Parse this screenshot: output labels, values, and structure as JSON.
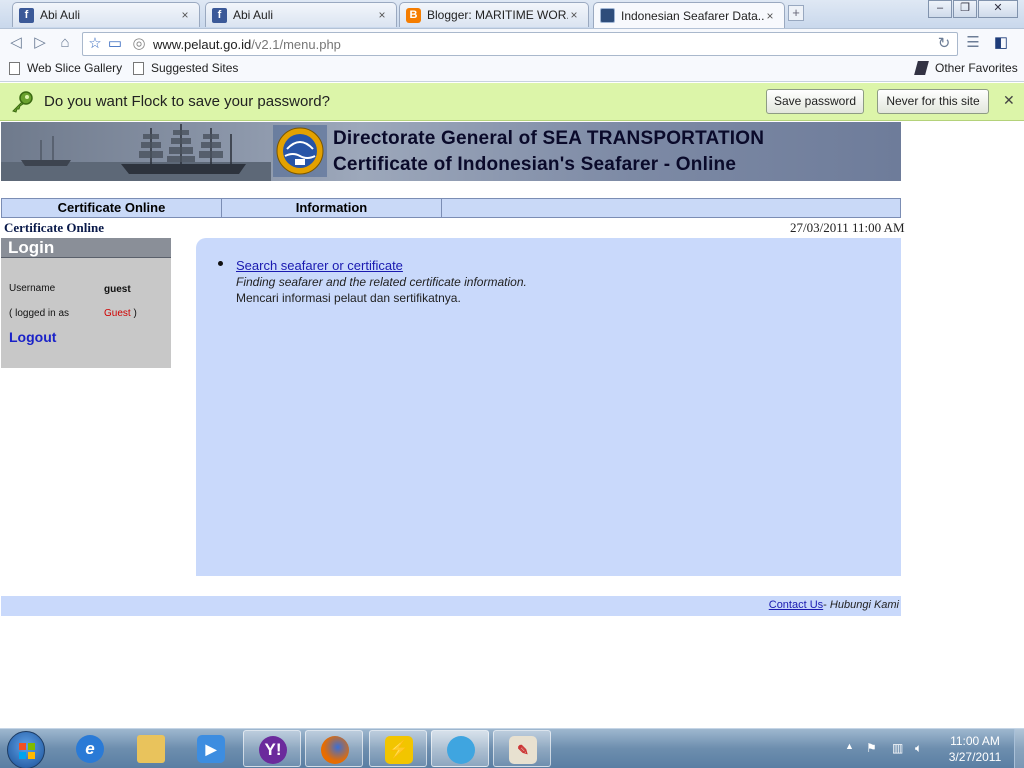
{
  "browser": {
    "tabs": [
      {
        "title": "Abi Auli",
        "favicon": "facebook-icon"
      },
      {
        "title": "Abi Auli",
        "favicon": "facebook-icon"
      },
      {
        "title": "Blogger: MARITIME WOR...",
        "favicon": "blogger-icon"
      },
      {
        "title": "Indonesian Seafarer Data...",
        "favicon": "seafarer-site-icon",
        "active": true
      }
    ],
    "url_host": "www.pelaut.go.id",
    "url_path": "/v2.1/menu.php",
    "bookmarks": [
      "Web Slice Gallery",
      "Suggested Sites"
    ],
    "other_favorites": "Other Favorites"
  },
  "password_bar": {
    "message": "Do you want Flock to save your password?",
    "save_label": "Save password",
    "never_label": "Never for this site"
  },
  "banner": {
    "line1": "Directorate General of SEA TRANSPORTATION",
    "line2": "Certificate of Indonesian's Seafarer - Online"
  },
  "nav": {
    "items": [
      "Certificate Online",
      "Information"
    ]
  },
  "breadcrumb": "Certificate Online",
  "datetime": "27/03/2011 11:00 AM",
  "login": {
    "title": "Login",
    "username_label": "Username",
    "username_value": "guest",
    "logged_in_prefix": "( logged in as",
    "logged_in_user": "Guest",
    "logged_in_suffix": ")",
    "logout_label": "Logout"
  },
  "main": {
    "link": "Search seafarer or certificate",
    "desc_en": "Finding seafarer and the related certificate information.",
    "desc_id": "Mencari informasi pelaut dan sertifikatnya."
  },
  "footer": {
    "contact": "Contact Us",
    "sep": "- ",
    "hubungi": "Hubungi Kami"
  },
  "taskbar": {
    "time": "11:00 AM",
    "date": "3/27/2011",
    "apps": [
      "internet-explorer-icon",
      "folder-icon",
      "media-player-icon",
      "yahoo-messenger-icon",
      "firefox-icon",
      "winamp-icon",
      "flock-icon",
      "paint-icon"
    ]
  },
  "colors": {
    "password_bar": "#dcf5a9",
    "nav_bg": "#c9d9f7",
    "content_bg": "#c9d9fb",
    "link": "#1a1ab0",
    "guest_red": "#d00000"
  }
}
